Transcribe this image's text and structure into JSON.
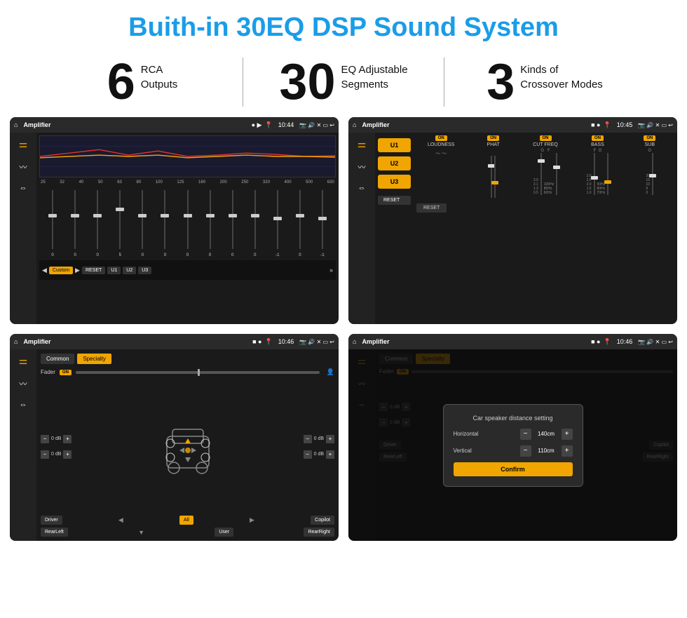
{
  "header": {
    "title": "Buith-in 30EQ DSP Sound System"
  },
  "stats": [
    {
      "number": "6",
      "label1": "RCA",
      "label2": "Outputs"
    },
    {
      "number": "30",
      "label1": "EQ Adjustable",
      "label2": "Segments"
    },
    {
      "number": "3",
      "label1": "Kinds of",
      "label2": "Crossover Modes"
    }
  ],
  "screens": {
    "eq": {
      "statusBar": {
        "title": "Amplifier",
        "time": "10:44"
      },
      "freqLabels": [
        "25",
        "32",
        "40",
        "50",
        "63",
        "80",
        "100",
        "125",
        "160",
        "200",
        "250",
        "320",
        "400",
        "500",
        "630"
      ],
      "sliderValues": [
        "0",
        "0",
        "0",
        "5",
        "0",
        "0",
        "0",
        "0",
        "0",
        "0",
        "-1",
        "0",
        "-1"
      ],
      "bottomButtons": [
        "Custom",
        "RESET",
        "U1",
        "U2",
        "U3"
      ]
    },
    "amp": {
      "statusBar": {
        "title": "Amplifier",
        "time": "10:45"
      },
      "presets": [
        "U1",
        "U2",
        "U3"
      ],
      "controls": [
        {
          "label": "LOUDNESS",
          "on": true
        },
        {
          "label": "PHAT",
          "on": true
        },
        {
          "label": "CUT FREQ",
          "on": true
        },
        {
          "label": "BASS",
          "on": true
        },
        {
          "label": "SUB",
          "on": true
        }
      ],
      "resetLabel": "RESET"
    },
    "cs": {
      "statusBar": {
        "title": "Amplifier",
        "time": "10:46"
      },
      "tabs": [
        "Common",
        "Specialty"
      ],
      "activeTab": "Specialty",
      "fader": {
        "label": "Fader",
        "on": true
      },
      "dbValues": [
        "0 dB",
        "0 dB",
        "0 dB",
        "0 dB"
      ],
      "bottomButtons": [
        "Driver",
        "All",
        "Copilot",
        "RearLeft",
        "User",
        "RearRight"
      ]
    },
    "dialog": {
      "statusBar": {
        "title": "Amplifier",
        "time": "10:46"
      },
      "tabs": [
        "Common",
        "Specialty"
      ],
      "dialogTitle": "Car speaker distance setting",
      "horizontal": {
        "label": "Horizontal",
        "value": "140cm"
      },
      "vertical": {
        "label": "Vertical",
        "value": "110cm"
      },
      "confirmLabel": "Confirm",
      "dbValues": [
        "0 dB",
        "0 dB"
      ],
      "bottomButtons": [
        "Driver",
        "Copilot",
        "RearLeft",
        "RearRight"
      ]
    }
  },
  "icons": {
    "home": "⌂",
    "location": "📍",
    "volume": "🔊",
    "back": "↩",
    "menu": "≡",
    "equalizer": "⚌",
    "wave": "〰",
    "arrows": "⇔"
  }
}
